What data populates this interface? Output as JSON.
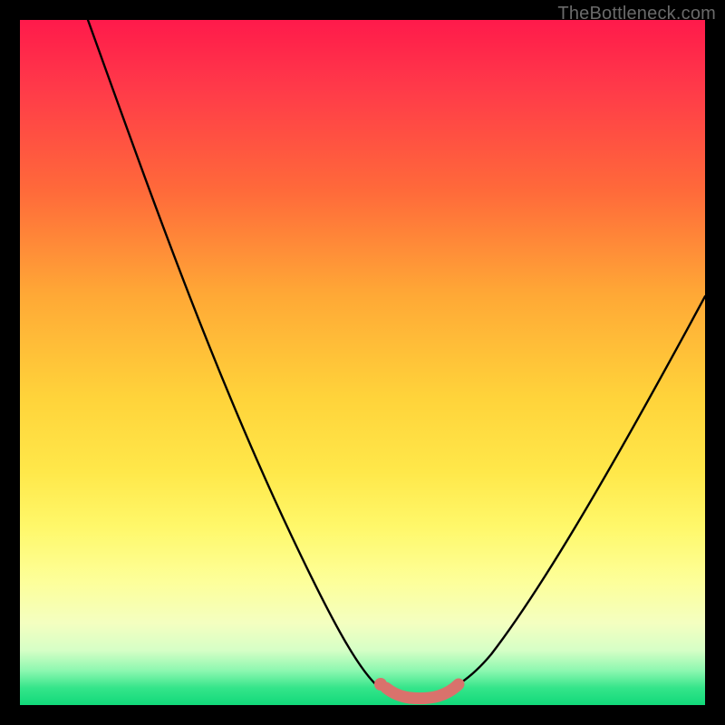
{
  "watermark": {
    "text": "TheBottleneck.com"
  },
  "colors": {
    "background": "#000000",
    "curve_stroke": "#000000",
    "marker_stroke": "#d9726c",
    "marker_fill": "#d9726c"
  },
  "chart_data": {
    "type": "line",
    "title": "",
    "xlabel": "",
    "ylabel": "",
    "xlim": [
      0,
      100
    ],
    "ylim": [
      0,
      100
    ],
    "grid": false,
    "legend": false,
    "series": [
      {
        "name": "bottleneck-curve",
        "x": [
          10,
          15,
          20,
          25,
          30,
          35,
          40,
          45,
          50,
          52,
          55,
          58,
          60,
          65,
          70,
          75,
          80,
          85,
          90,
          95,
          100
        ],
        "y": [
          100,
          89,
          78,
          67,
          56,
          45,
          34,
          23,
          12,
          6,
          2,
          1,
          1,
          2,
          6,
          13,
          22,
          32,
          43,
          52,
          60
        ]
      }
    ],
    "markers": {
      "name": "optimal-band",
      "x": [
        52.5,
        54,
        56,
        58,
        60,
        62,
        63.5
      ],
      "y": [
        3.3,
        2.2,
        1.4,
        1.1,
        1.1,
        1.6,
        2.6
      ]
    }
  }
}
